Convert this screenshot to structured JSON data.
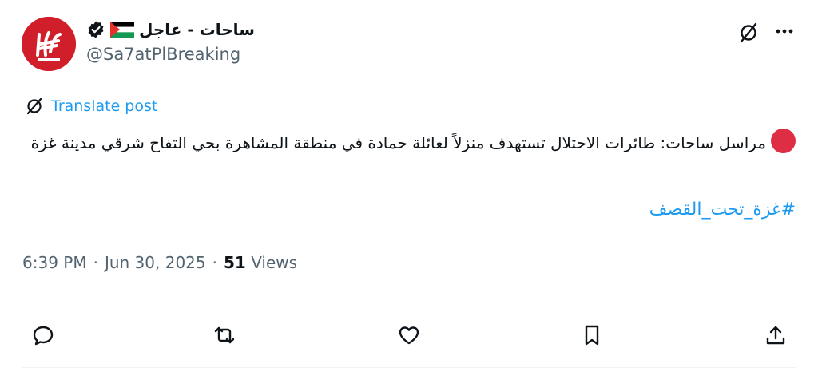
{
  "tweet": {
    "display_name": "ساحات - عاجل",
    "handle": "@Sa7atPlBreaking",
    "translate_label": "Translate post",
    "text": "مراسل ساحات: طائرات الاحتلال تستهدف منزلاً لعائلة حمادة في منطقة المشاهرة بحي التفاح شرقي مدينة غزة",
    "hashtag": "#غزة_تحت_القصف",
    "time": "6:39 PM",
    "date": "Jun 30, 2025",
    "views_count": "51",
    "views_label": "Views"
  },
  "icons": {
    "verified": "verified-badge-icon",
    "flag": "palestine-flag-icon",
    "translate": "translate-icon",
    "more": "more-icon",
    "reply": "reply-icon",
    "repost": "repost-icon",
    "like": "like-icon",
    "bookmark": "bookmark-icon",
    "share": "share-icon"
  },
  "colors": {
    "accent": "#1d9bf0",
    "secondary_text": "#536471",
    "avatar_bg": "#d01f2a",
    "alert_dot": "#dd2e44"
  }
}
